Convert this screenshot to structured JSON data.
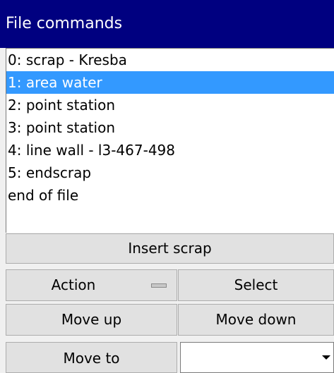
{
  "title": "File commands",
  "items": [
    {
      "label": "0: scrap - Kresba",
      "selected": false
    },
    {
      "label": "1: area water",
      "selected": true
    },
    {
      "label": "2: point station",
      "selected": false
    },
    {
      "label": "3: point station",
      "selected": false
    },
    {
      "label": "4: line wall - l3-467-498",
      "selected": false
    },
    {
      "label": "5: endscrap",
      "selected": false
    },
    {
      "label": "end of file",
      "selected": false
    }
  ],
  "buttons": {
    "insert_scrap": "Insert scrap",
    "action": "Action",
    "select": "Select",
    "move_up": "Move up",
    "move_down": "Move down",
    "move_to": "Move to"
  },
  "move_to_combo": {
    "value": ""
  },
  "colors": {
    "title_bg": "#000080",
    "selection": "#3399ff"
  }
}
